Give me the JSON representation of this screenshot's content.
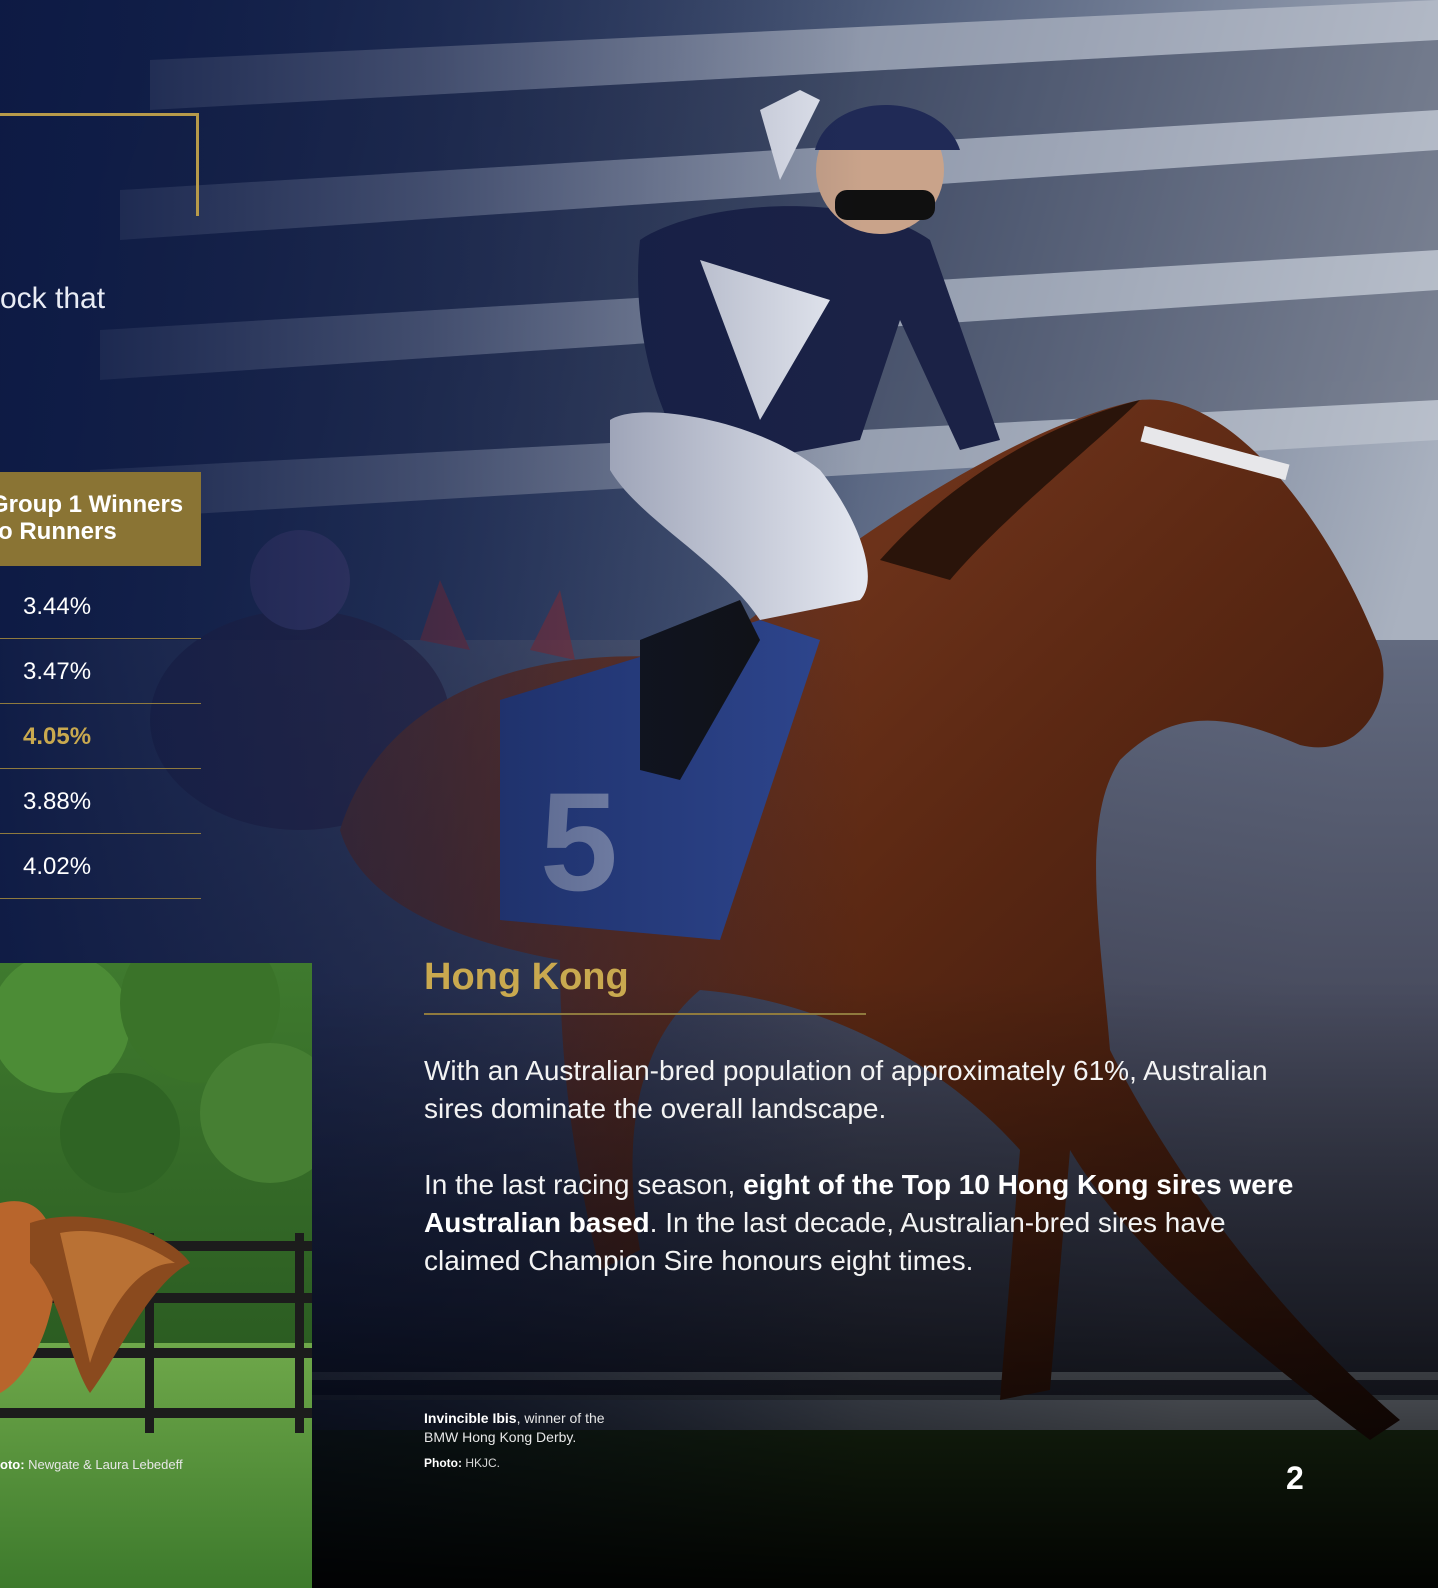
{
  "intro": {
    "text": "ock that"
  },
  "table": {
    "header_line1": "Group 1 Winners",
    "header_line2": "to Runners",
    "rows": [
      {
        "value": "3.44%",
        "highlight": false
      },
      {
        "value": "3.47%",
        "highlight": false
      },
      {
        "value": "4.05%",
        "highlight": true
      },
      {
        "value": "3.88%",
        "highlight": false
      },
      {
        "value": "4.02%",
        "highlight": false
      }
    ]
  },
  "left_photo": {
    "credit_label": "oto:",
    "credit_text": "Newgate & Laura Lebedeff"
  },
  "hong_kong": {
    "title": "Hong Kong",
    "para1": "With an Australian-bred population of approximately 61%, Australian sires dominate the overall landscape.",
    "para2_before": "In the last racing season, ",
    "para2_bold": "eight of the Top 10 Hong Kong sires were Australian based",
    "para2_after": ". In the last decade, Australian-bred sires have claimed Champion Sire honours eight times.",
    "caption_bold": "Invincible Ibis",
    "caption_rest": ", winner of the",
    "caption_line2": "BMW Hong Kong Derby.",
    "photo_label": "Photo:",
    "photo_credit": "HKJC."
  },
  "page_number": "2",
  "colors": {
    "gold": "#b79a4a",
    "gold_text": "#c9a94f",
    "navy": "#141e3c"
  }
}
